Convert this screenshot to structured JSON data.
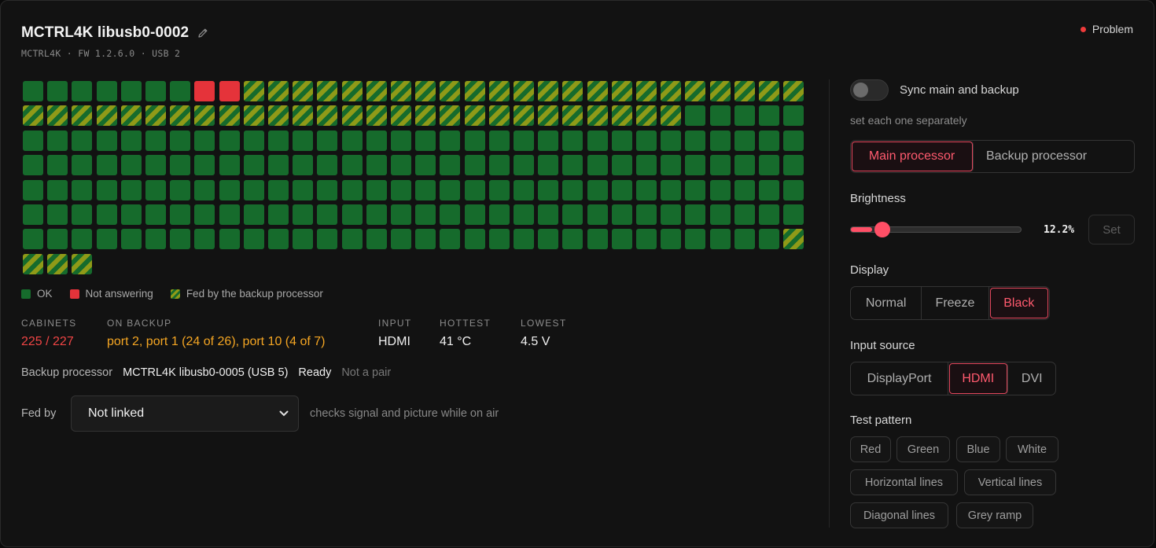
{
  "header": {
    "title": "MCTRL4K libusb0-0002",
    "subtitle": "MCTRL4K · FW 1.2.6.0 · USB 2",
    "status": "Problem",
    "status_color": "#ef3b3b"
  },
  "cabinet_grid": {
    "columns": 32,
    "rows": [
      "OOOOOOOXXBBBBBBBBBBBBBBBBBBBBBBB",
      "BBBBBBBBBBBBBBBBBBBBBBBBBBBOOOOO",
      "OOOOOOOOOOOOOOOOOOOOOOOOOOOOOOOO",
      "OOOOOOOOOOOOOOOOOOOOOOOOOOOOOOOO",
      "OOOOOOOOOOOOOOOOOOOOOOOOOOOOOOOO",
      "OOOOOOOOOOOOOOOOOOOOOOOOOOOOOOOO",
      "OOOOOOOOOOOOOOOOOOOOOOOOOOOOOOOB",
      "BBB"
    ],
    "colors": {
      "ok": "#166b2c",
      "not_answering": "#e5333a",
      "backup_stripe": "#8f9a18"
    }
  },
  "legend": [
    {
      "kind": "ok",
      "label": "OK"
    },
    {
      "kind": "bad",
      "label": "Not answering"
    },
    {
      "kind": "bk",
      "label": "Fed by the backup processor"
    }
  ],
  "stats": {
    "cabinets": {
      "label": "CABINETS",
      "value": "225 / 227"
    },
    "on_backup": {
      "label": "ON BACKUP",
      "value": "port 2, port 1 (24 of 26), port 10 (4 of 7)"
    },
    "input": {
      "label": "INPUT",
      "value": "HDMI"
    },
    "hottest": {
      "label": "HOTTEST",
      "value": "41 °C"
    },
    "lowest": {
      "label": "LOWEST",
      "value": "4.5 V"
    }
  },
  "backup": {
    "label": "Backup processor",
    "name": "MCTRL4K libusb0-0005 (USB 5)",
    "state": "Ready",
    "pair": "Not a pair"
  },
  "fed_by": {
    "label": "Fed by",
    "selected": "Not linked",
    "hint": "checks signal and picture while on air"
  },
  "sync": {
    "label": "Sync main and backup",
    "enabled": false,
    "hint": "set each one separately"
  },
  "processor_tabs": {
    "options": [
      "Main processor",
      "Backup processor"
    ],
    "active": 0
  },
  "brightness": {
    "label": "Brightness",
    "value_text": "12.2%",
    "value": 0.122,
    "set_label": "Set"
  },
  "display": {
    "label": "Display",
    "options": [
      "Normal",
      "Freeze",
      "Black"
    ],
    "active": 2
  },
  "input_source": {
    "label": "Input source",
    "options": [
      "DisplayPort",
      "HDMI",
      "DVI"
    ],
    "active": 1
  },
  "test_pattern": {
    "label": "Test pattern",
    "options": [
      "Red",
      "Green",
      "Blue",
      "White",
      "Horizontal lines",
      "Vertical lines",
      "Diagonal lines",
      "Grey ramp"
    ]
  },
  "accent_color": "#ff5a6e"
}
